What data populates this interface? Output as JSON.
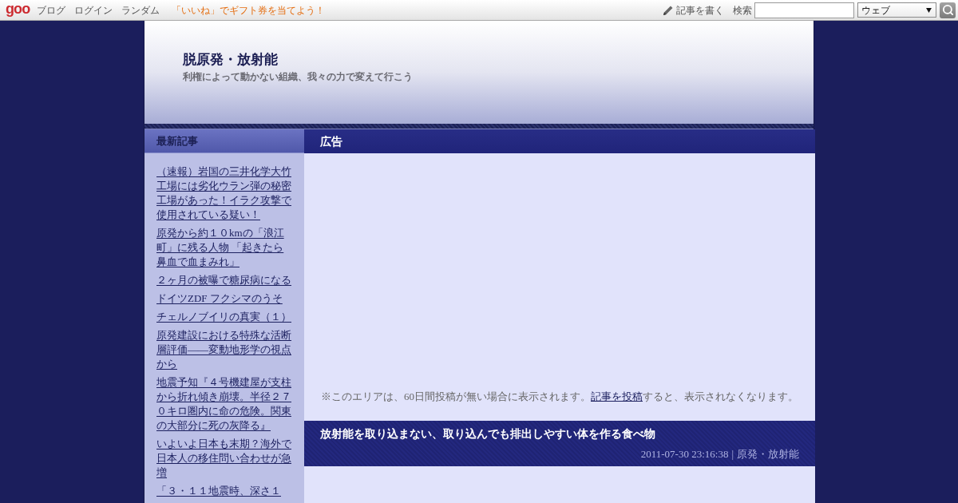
{
  "top_bar": {
    "logo": "goo",
    "links": [
      "ブログ",
      "ログイン",
      "ランダム"
    ],
    "promo": "「いいね」でギフト券を当てよう！",
    "write_link": "記事を書く",
    "search_label": "検索",
    "search_scope": "ウェブ"
  },
  "header": {
    "title": "脱原発・放射能",
    "tagline": "利権によって動かない組織、我々の力で変えて行こう"
  },
  "sidebar": {
    "heading": "最新記事",
    "items": [
      "（速報）岩国の三井化学大竹工場には劣化ウラン弾の秘密工場があった！イラク攻撃で使用されている疑い！",
      "原発から約１０kmの「浪江町」に残る人物 「起きたら鼻血で血まみれ」",
      "２ヶ月の被曝で糖尿病になる",
      "ドイツZDF フクシマのうそ",
      "チェルノブイリの真実（１）",
      "原発建設における特殊な活断層評価――変動地形学の視点から",
      "地震予知『４号機建屋が支柱から折れ傾き崩壊。半径２７０キロ圏内に命の危険。関東の大部分に死の灰降る』",
      "いよいよ日本も末期？海外で日本人の移住問い合わせが急増",
      "「３・１１地震時、深さ１"
    ]
  },
  "ad_section": {
    "heading": "広告",
    "notice_before": "※このエリアは、60日間投稿が無い場合に表示されます。",
    "notice_link": "記事を投稿",
    "notice_after": "すると、表示されなくなります。"
  },
  "article": {
    "title": "放射能を取り込まない、取り込んでも排出しやすい体を作る食べ物",
    "date": "2011-07-30 23:16:38",
    "separator": "|",
    "category": "原発・放射能"
  }
}
